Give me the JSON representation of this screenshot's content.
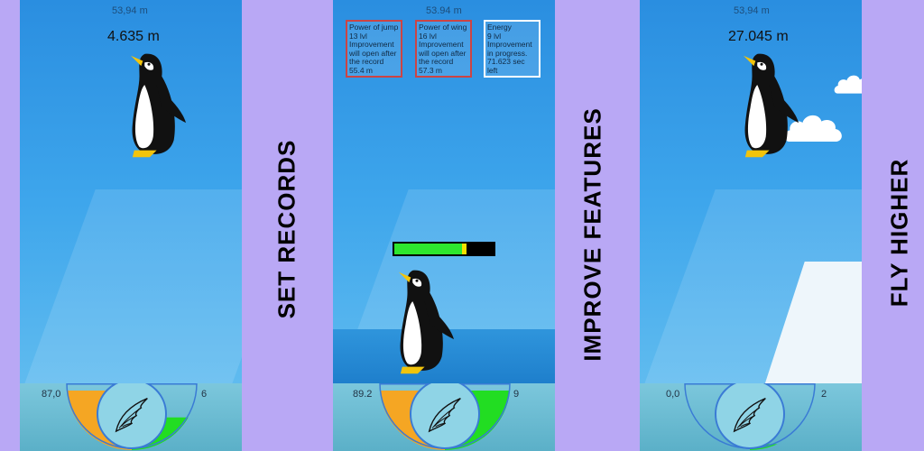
{
  "colors": {
    "background": "#b9a8f5",
    "sky": "#3ea6ec",
    "ice": "#7cc7dc",
    "gauge_left": "#f5a623",
    "gauge_right": "#22dd22",
    "gauge_outline": "#3a7bd5",
    "energy_bar": "#2ee62e",
    "energy_marker": "#f6e000"
  },
  "panels": [
    {
      "record": "53,94 m",
      "height": "4.635 m",
      "left_value": "87,0",
      "right_value": "6",
      "gauge": {
        "left_fill": 1.0,
        "right_fill": 0.55
      }
    },
    {
      "record": "53.94 m",
      "left_value": "89.2",
      "right_value": "9",
      "gauge": {
        "left_fill": 1.0,
        "right_fill": 1.0
      },
      "energy_level": 0.68,
      "info_boxes": [
        {
          "lines": [
            "Power of jump",
            "13 lvl",
            "Improvement",
            "will open after",
            "the record",
            "55.4 m"
          ]
        },
        {
          "lines": [
            "Power of wing",
            "16 lvl",
            "Improvement",
            "will open after",
            "the record",
            "57.3 m"
          ]
        },
        {
          "lines": [
            "Energy",
            "9 lvl",
            "Improvement",
            "in progress.",
            "71.623 sec",
            "left"
          ]
        }
      ]
    },
    {
      "record": "53,94 m",
      "height": "27.045 m",
      "left_value": "0,0",
      "right_value": "2",
      "gauge": {
        "left_fill": 0.0,
        "right_fill": 0.1
      }
    }
  ],
  "captions": [
    "SET RECORDS",
    "IMPROVE FEATURES",
    "FLY HIGHER"
  ]
}
